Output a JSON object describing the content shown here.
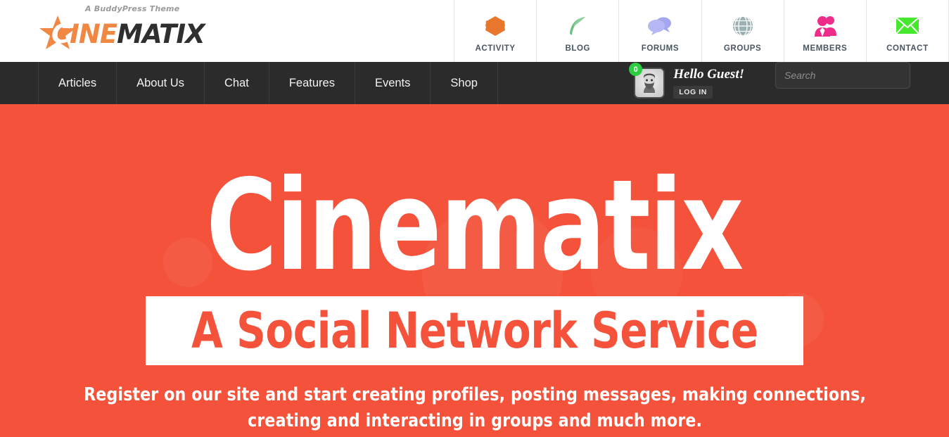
{
  "header": {
    "logo": {
      "tagline": "A BuddyPress Theme",
      "word_c": "C",
      "word_ine": "INE",
      "word_matix": "MATIX",
      "star_color": "#F08743"
    },
    "icon_nav": [
      {
        "label": "ACTIVITY",
        "icon": "layers-icon",
        "color": "#E8762C"
      },
      {
        "label": "BLOG",
        "icon": "feather-icon",
        "color": "#6DBE82"
      },
      {
        "label": "FORUMS",
        "icon": "speech-bubbles-icon",
        "color": "#A3A7F0"
      },
      {
        "label": "GROUPS",
        "icon": "globe-icon",
        "color": "#9BB0B3"
      },
      {
        "label": "MEMBERS",
        "icon": "people-icon",
        "color": "#EE2C8A"
      },
      {
        "label": "CONTACT",
        "icon": "envelope-icon",
        "color": "#45E82C"
      }
    ]
  },
  "nav": {
    "items": [
      {
        "label": "Articles"
      },
      {
        "label": "About Us"
      },
      {
        "label": "Chat"
      },
      {
        "label": "Features"
      },
      {
        "label": "Events"
      },
      {
        "label": "Shop"
      }
    ],
    "user": {
      "notification_count": "0",
      "greeting": "Hello Guest!",
      "login_label": "LOG IN",
      "avatar_alt": "guest-avatar"
    },
    "search": {
      "placeholder": "Search",
      "value": "",
      "icon": "magnifier-icon"
    }
  },
  "hero": {
    "title": "Cinematix",
    "banner": "A Social Network Service",
    "subtitle": "Register on our site and start creating profiles, posting messages, making connections, creating and interacting in groups and much more.",
    "background_color": "#F4523B",
    "banner_background": "#FFFFFF",
    "banner_text_color": "#F4523B"
  }
}
